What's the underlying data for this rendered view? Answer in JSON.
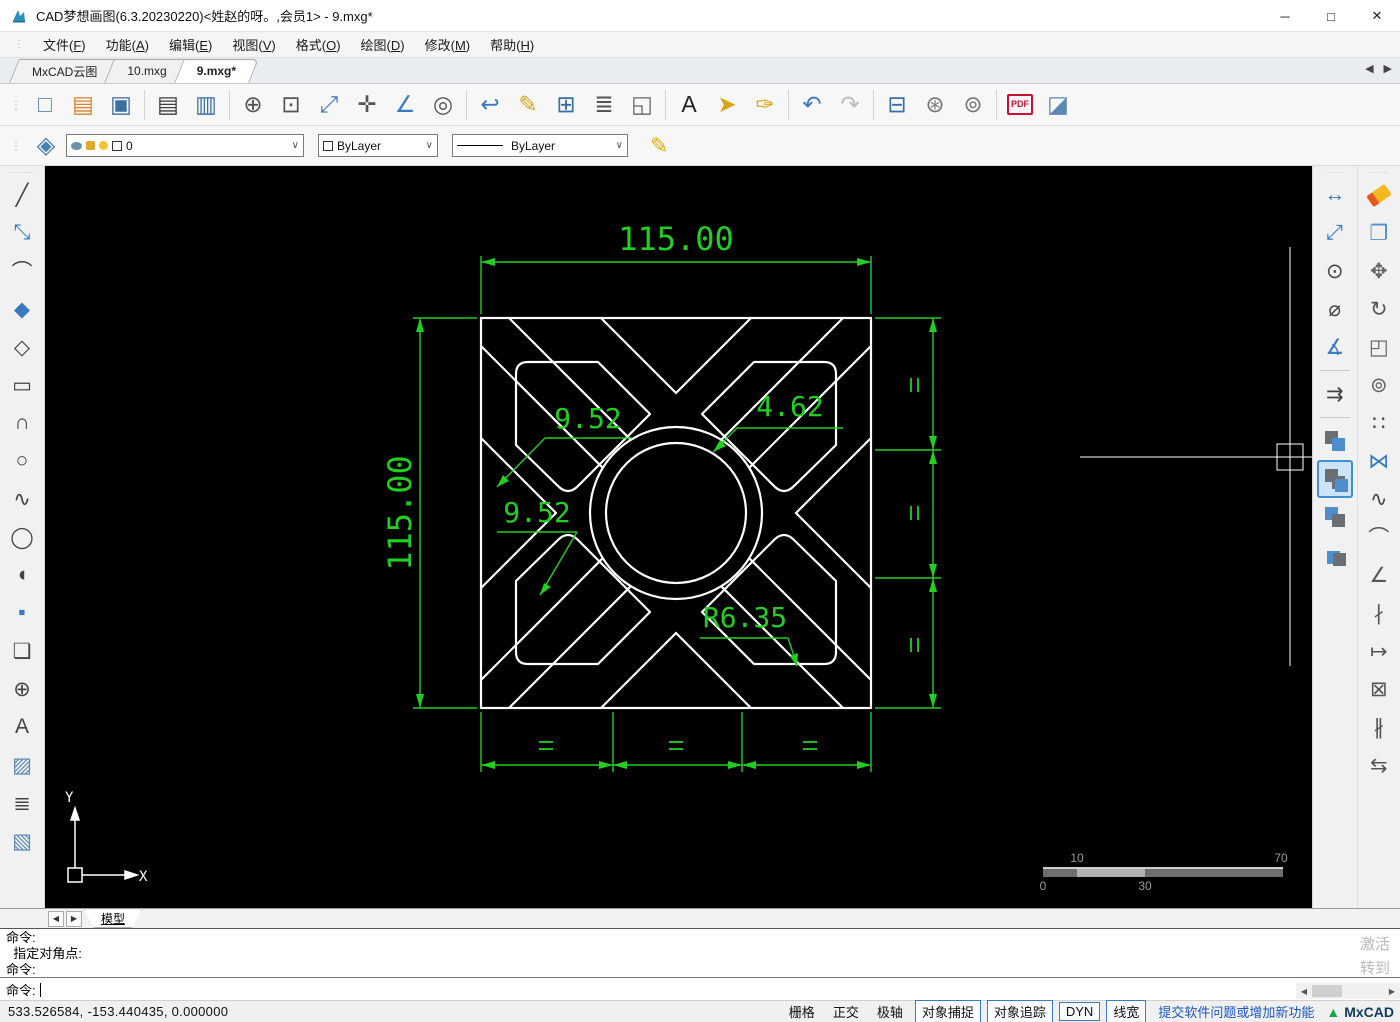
{
  "window": {
    "title": "CAD梦想画图(6.3.20230220)<姓赵的呀。,会员1> - 9.mxg*",
    "minimize": "─",
    "maximize": "□",
    "close": "✕"
  },
  "menu": {
    "items": [
      {
        "name": "file",
        "label": "文件",
        "key": "F"
      },
      {
        "name": "function",
        "label": "功能",
        "key": "A"
      },
      {
        "name": "edit",
        "label": "编辑",
        "key": "E"
      },
      {
        "name": "view",
        "label": "视图",
        "key": "V"
      },
      {
        "name": "format",
        "label": "格式",
        "key": "O"
      },
      {
        "name": "draw",
        "label": "绘图",
        "key": "D"
      },
      {
        "name": "modify",
        "label": "修改",
        "key": "M"
      },
      {
        "name": "help",
        "label": "帮助",
        "key": "H"
      }
    ]
  },
  "tabs": {
    "nav_left": "◀",
    "nav_right": "▶",
    "items": [
      {
        "name": "mxcad-cloud",
        "label": "MxCAD云图",
        "active": false
      },
      {
        "name": "doc-10",
        "label": "10.mxg",
        "active": false
      },
      {
        "name": "doc-9",
        "label": "9.mxg*",
        "active": true
      }
    ]
  },
  "toolbar": {
    "groups": [
      [
        "new-file",
        "open-project",
        "save"
      ],
      [
        "open-folder",
        "save-as"
      ],
      [
        "zoom-inout",
        "zoom-window",
        "zoom-extents",
        "pan",
        "zoom-dynamic",
        "zoom-center"
      ],
      [
        "view-previous",
        "sketch",
        "color-palette",
        "layer-list",
        "viewport"
      ],
      [
        "text-style",
        "quick-select",
        "customize"
      ],
      [
        "undo",
        "redo"
      ],
      [
        "print",
        "web-preview",
        "web-publish"
      ],
      [
        "pdf-export",
        "insert-image"
      ]
    ]
  },
  "properties_bar": {
    "layer": {
      "value": "0"
    },
    "color": {
      "value": "ByLayer"
    },
    "linetype": {
      "value": "ByLayer"
    }
  },
  "left_toolbar": {
    "items": [
      "line",
      "xline",
      "arc",
      "polygon-filled",
      "polygon",
      "rectangle",
      "arc-3p",
      "circle",
      "spline",
      "ellipse",
      "ellipse-arc",
      "point",
      "insert-block",
      "make-block",
      "text",
      "image",
      "mtext",
      "hatch"
    ]
  },
  "right_toolbar": {
    "dim_column": [
      {
        "name": "dim-linear"
      },
      {
        "name": "dim-aligned"
      },
      {
        "name": "dim-radius"
      },
      {
        "name": "dim-diameter"
      },
      {
        "name": "dim-angular"
      },
      {
        "name": "divider"
      },
      {
        "name": "dim-quick"
      },
      {
        "name": "divider"
      },
      {
        "name": "draworder-1"
      },
      {
        "name": "draworder-2",
        "active": true
      },
      {
        "name": "draworder-3"
      },
      {
        "name": "draworder-4"
      }
    ],
    "modify_column": [
      {
        "name": "erase"
      },
      {
        "name": "copy"
      },
      {
        "name": "move"
      },
      {
        "name": "rotate"
      },
      {
        "name": "scale"
      },
      {
        "name": "offset"
      },
      {
        "name": "array"
      },
      {
        "name": "mirror"
      },
      {
        "name": "spline-edit"
      },
      {
        "name": "fillet"
      },
      {
        "name": "chamfer"
      },
      {
        "name": "trim"
      },
      {
        "name": "extend"
      },
      {
        "name": "explode"
      },
      {
        "name": "break"
      },
      {
        "name": "join"
      }
    ]
  },
  "canvas": {
    "colors": {
      "geometry": "#ffffff",
      "dimension": "#21cf21",
      "background": "#000000"
    },
    "dimensions": {
      "top": "115.00",
      "left": "115.00",
      "leader1": "9.52",
      "leader2": "9.52",
      "leader3": "4.62",
      "radius": "R6.35"
    },
    "scale_bar": {
      "label_10": "10",
      "label_70": "70",
      "label_0": "0",
      "label_30": "30"
    },
    "ucs": {
      "x_label": "X",
      "y_label": "Y"
    }
  },
  "model_bar": {
    "nav_left": "◀",
    "nav_right": "▶",
    "tab": "模型"
  },
  "command": {
    "history": [
      "命令:",
      "  指定对角点:",
      "命令:"
    ],
    "prompt": "命令:",
    "watermark_line1": "激活",
    "watermark_line2": "转到"
  },
  "status": {
    "coords": "533.526584,  -153.440435,  0.000000",
    "toggles": [
      {
        "label": "栅格",
        "active": false
      },
      {
        "label": "正交",
        "active": false
      },
      {
        "label": "极轴",
        "active": false
      },
      {
        "label": "对象捕捉",
        "active": true
      },
      {
        "label": "对象追踪",
        "active": true
      },
      {
        "label": "DYN",
        "active": true
      },
      {
        "label": "线宽",
        "active": true
      }
    ],
    "link": "提交软件问题或增加新功能",
    "brand": "MxCAD"
  }
}
